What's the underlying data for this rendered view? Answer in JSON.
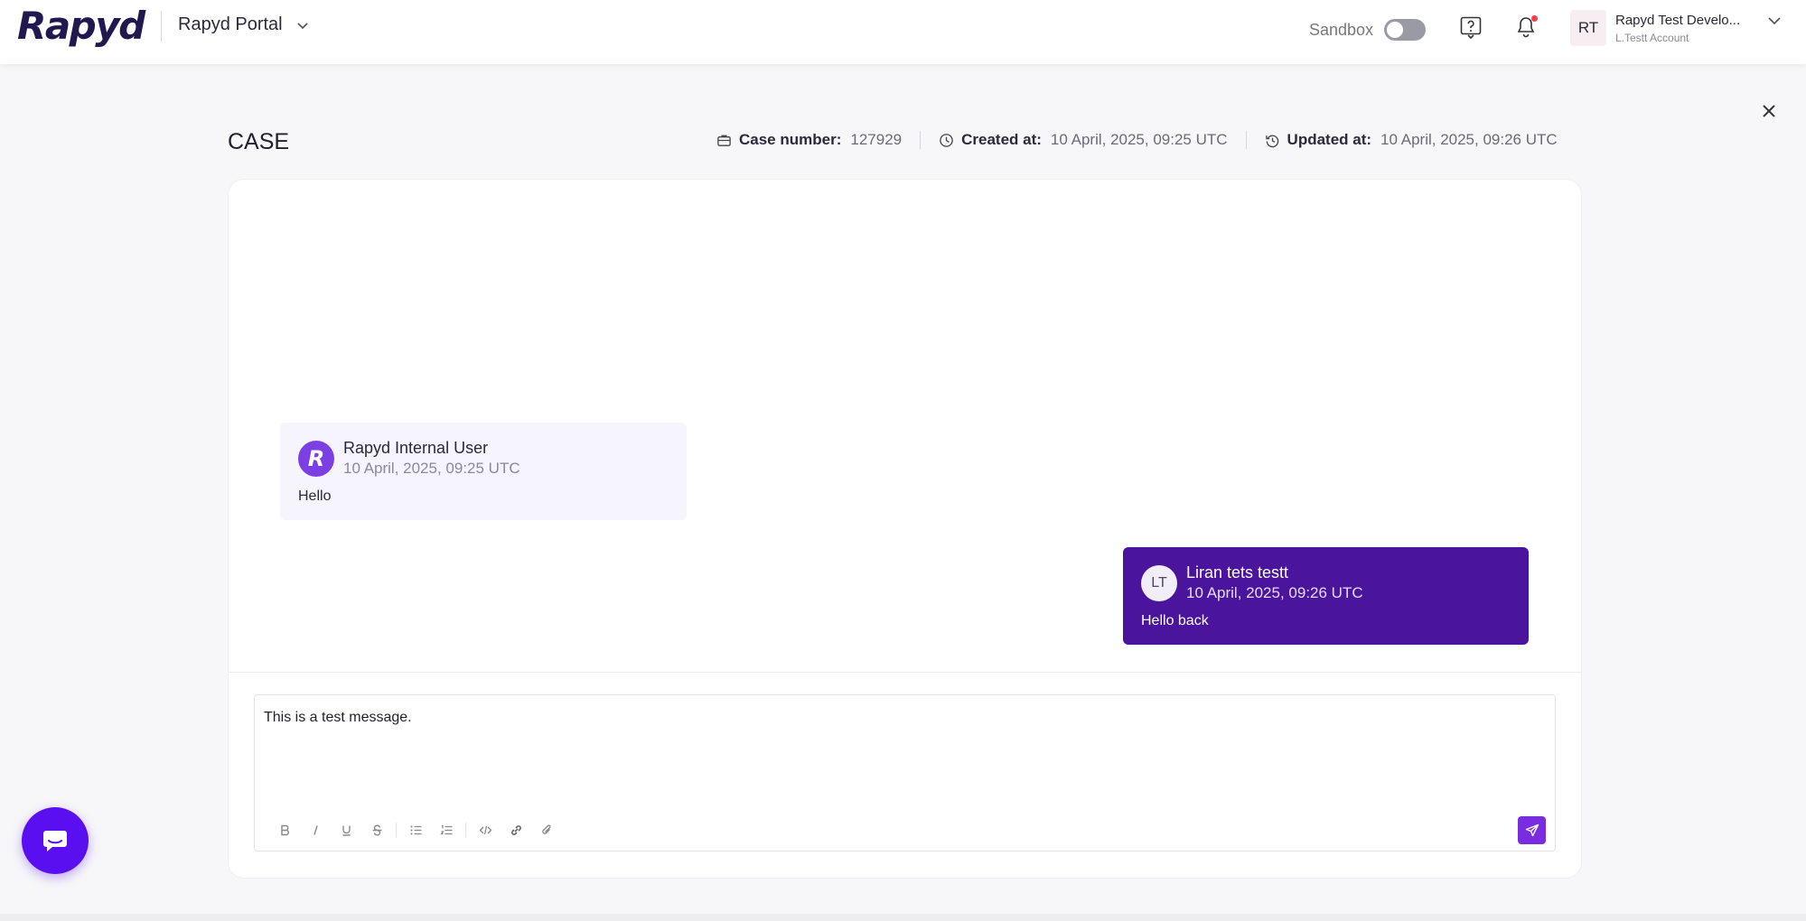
{
  "header": {
    "logo_text": "Rapyd",
    "portal_label": "Rapyd Portal",
    "sandbox_label": "Sandbox",
    "sandbox_enabled": false,
    "has_unread_notifications": true,
    "account": {
      "initials": "RT",
      "name": "Rapyd Test Develo...",
      "sub": "L.Testt Account"
    }
  },
  "case": {
    "title": "CASE",
    "case_number_label": "Case number:",
    "case_number": "127929",
    "created_label": "Created at:",
    "created_at": "10 April, 2025, 09:25 UTC",
    "updated_label": "Updated at:",
    "updated_at": "10 April, 2025, 09:26 UTC"
  },
  "messages": [
    {
      "avatar": "R",
      "sender": "Rapyd Internal User",
      "timestamp": "10 April, 2025, 09:25 UTC",
      "text": "Hello",
      "direction": "incoming"
    },
    {
      "avatar": "LT",
      "sender": "Liran tets testt",
      "timestamp": "10 April, 2025, 09:26 UTC",
      "text": "Hello back",
      "direction": "outgoing"
    }
  ],
  "composer": {
    "value": "This is a test message.",
    "tools": [
      "bold-icon",
      "italic-icon",
      "underline-icon",
      "strikethrough-icon",
      "bullet-list-icon",
      "numbered-list-icon",
      "code-icon",
      "link-icon",
      "attachment-icon"
    ]
  },
  "colors": {
    "brand_dark": "#21184f",
    "accent_purple": "#7a2de0",
    "outgoing_bubble": "#4a159c",
    "incoming_bubble": "#f6f4fd",
    "chat_fab": "#5a0ff0",
    "notification_dot": "#ff3b4a"
  }
}
